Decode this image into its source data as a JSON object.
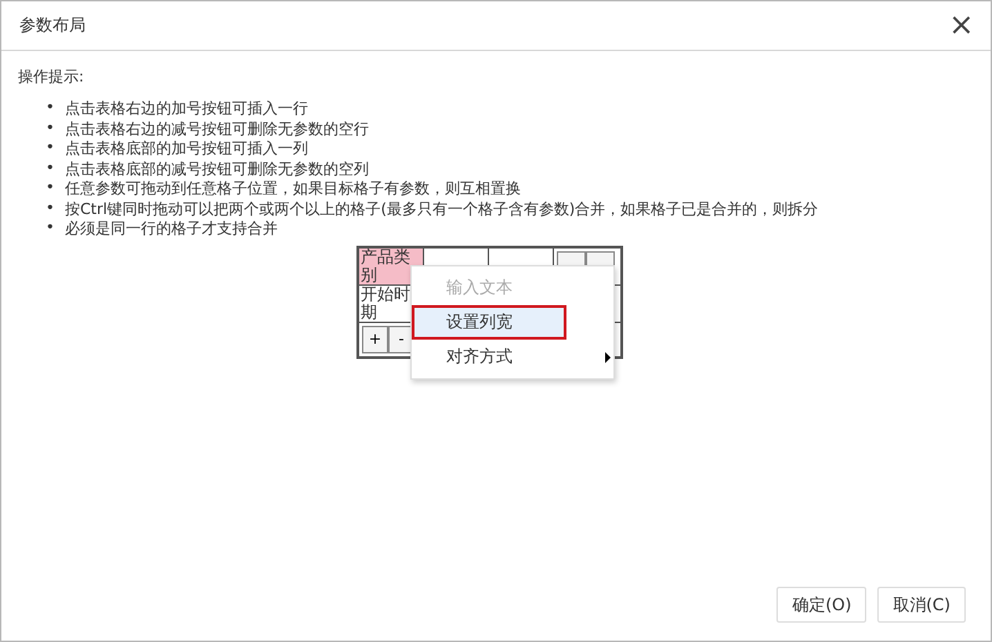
{
  "window": {
    "title": "参数布局",
    "close": "×"
  },
  "hint_title": "操作提示:",
  "bullet": "•",
  "hints": [
    "点击表格右边的加号按钮可插入一行",
    "点击表格右边的减号按钮可删除无参数的空行",
    "点击表格底部的加号按钮可插入一列",
    "点击表格底部的减号按钮可删除无参数的空列",
    "任意参数可拖动到任意格子位置，如果目标格子有参数，则互相置换",
    "按Ctrl键同时拖动可以把两个或两个以上的格子(最多只有一个格子含有参数)合并，如果格子已是合并的，则拆分",
    "必须是同一行的格子才支持合并"
  ],
  "grid": {
    "rows": [
      {
        "cells": [
          {
            "text": "产品类别",
            "selected": true
          },
          {
            "text": "",
            "selected": false
          },
          {
            "text": "",
            "selected": false
          }
        ]
      },
      {
        "cells": [
          {
            "text": "开始时期",
            "selected": false
          }
        ]
      }
    ],
    "column_buttons": [
      "+",
      "-"
    ]
  },
  "context_menu": [
    {
      "label": "输入文本",
      "disabled": true,
      "highlighted": false,
      "marked": false,
      "submenu": false
    },
    {
      "label": "设置列宽",
      "disabled": false,
      "highlighted": true,
      "marked": true,
      "submenu": false
    },
    {
      "label": "对齐方式",
      "disabled": false,
      "highlighted": false,
      "marked": false,
      "submenu": true
    }
  ],
  "buttons": [
    "确定(O)",
    "取消(C)"
  ]
}
